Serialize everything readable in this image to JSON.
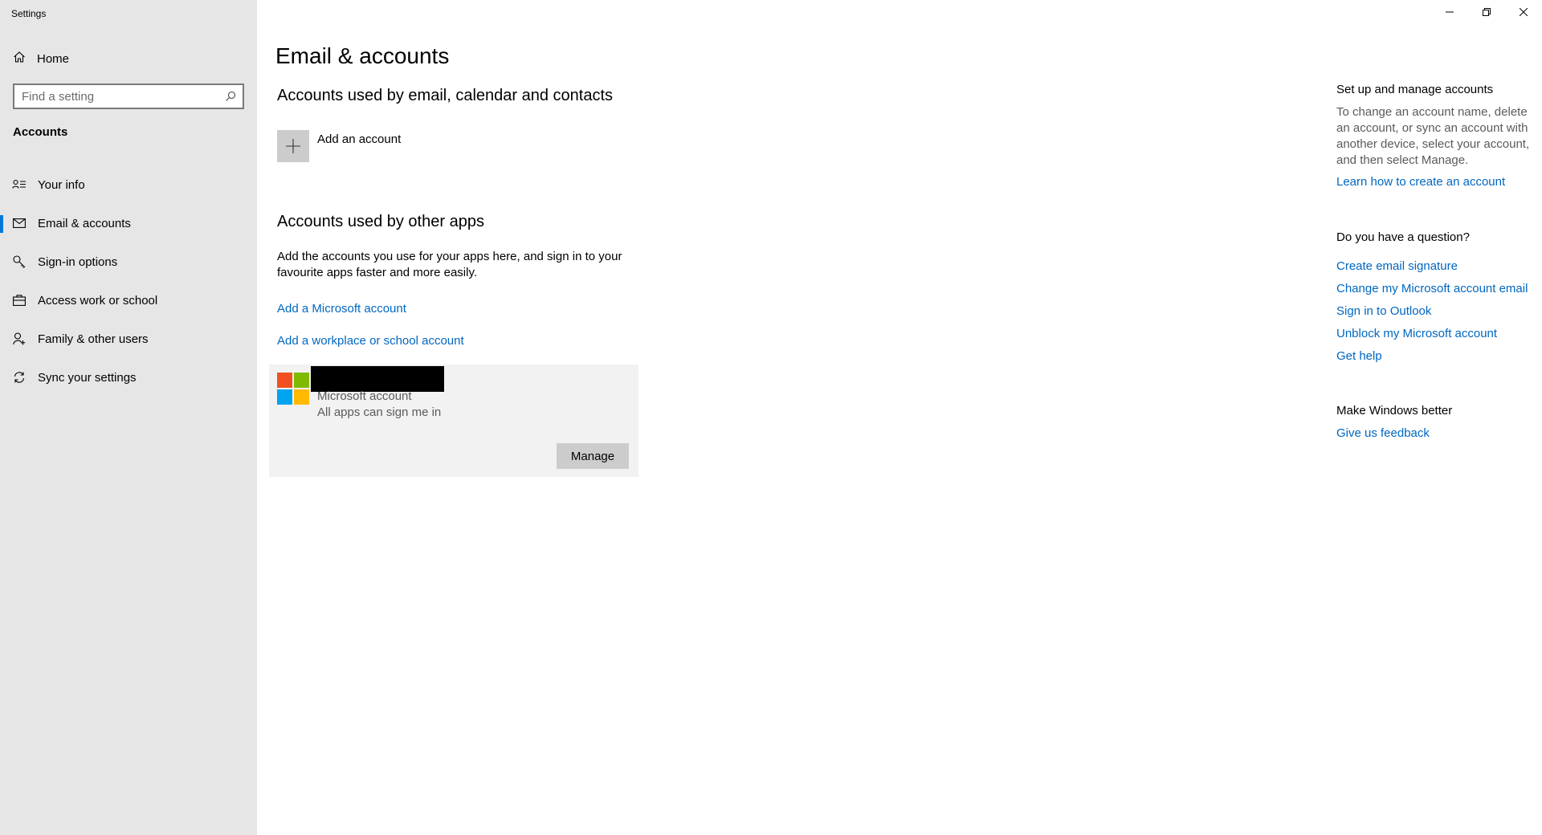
{
  "window": {
    "title": "Settings",
    "controls": {
      "minimize": "minimize-icon",
      "restore": "restore-icon",
      "close": "close-icon"
    }
  },
  "sidebar": {
    "home_label": "Home",
    "search_placeholder": "Find a setting",
    "section_title": "Accounts",
    "items": [
      {
        "label": "Your info",
        "icon": "person-card-icon",
        "active": false
      },
      {
        "label": "Email & accounts",
        "icon": "mail-icon",
        "active": true
      },
      {
        "label": "Sign-in options",
        "icon": "key-icon",
        "active": false
      },
      {
        "label": "Access work or school",
        "icon": "briefcase-icon",
        "active": false
      },
      {
        "label": "Family & other users",
        "icon": "person-add-icon",
        "active": false
      },
      {
        "label": "Sync your settings",
        "icon": "sync-icon",
        "active": false
      }
    ]
  },
  "main": {
    "title": "Email & accounts",
    "email_section": {
      "heading": "Accounts used by email, calendar and contacts",
      "add_account_label": "Add an account"
    },
    "apps_section": {
      "heading": "Accounts used by other apps",
      "description": "Add the accounts you use for your apps here, and sign in to your favourite apps faster and more easily.",
      "add_microsoft_link": "Add a Microsoft account",
      "add_workplace_link": "Add a workplace or school account"
    },
    "account_card": {
      "type": "Microsoft account",
      "status": "All apps can sign me in",
      "manage_label": "Manage"
    }
  },
  "right_panel": {
    "setup": {
      "heading": "Set up and manage accounts",
      "text": "To change an account name, delete an account, or sync an account with another device, select your account, and then select Manage.",
      "link": "Learn how to create an account"
    },
    "question": {
      "heading": "Do you have a question?",
      "links": [
        "Create email signature",
        "Change my Microsoft account email",
        "Sign in to Outlook",
        "Unblock my Microsoft account",
        "Get help"
      ]
    },
    "feedback": {
      "heading": "Make Windows better",
      "link": "Give us feedback"
    }
  },
  "colors": {
    "accent": "#0078d7",
    "link": "#0067c0",
    "sidebar_bg": "#e6e6e6",
    "card_bg": "#f2f2f2",
    "ms_red": "#f25022",
    "ms_green": "#7fba00",
    "ms_blue": "#00a4ef",
    "ms_yellow": "#ffb900"
  }
}
